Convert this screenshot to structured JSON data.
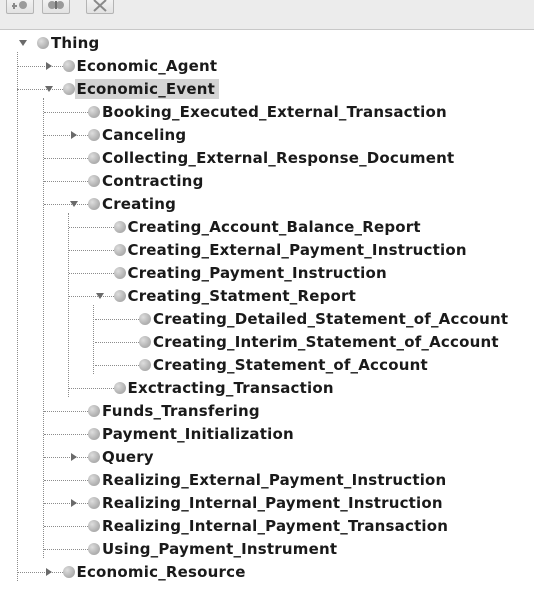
{
  "toolbar": {
    "buttons": [
      {
        "icon": "add-subclass-icon"
      },
      {
        "icon": "add-sibling-icon"
      },
      {
        "icon": "delete-class-icon"
      }
    ]
  },
  "colors": {
    "selection": "#d4d4d4",
    "node_dot": "#b6b6b6",
    "text": "#1a1a1a",
    "connector": "#8c8c8c"
  },
  "tree": {
    "nodes": [
      {
        "label": "Thing",
        "depth": 0,
        "state": "expanded",
        "selected": false
      },
      {
        "label": "Economic_Agent",
        "depth": 1,
        "state": "collapsed",
        "selected": false
      },
      {
        "label": "Economic_Event",
        "depth": 1,
        "state": "expanded",
        "selected": true
      },
      {
        "label": "Booking_Executed_External_Transaction",
        "depth": 2,
        "state": "leaf",
        "selected": false
      },
      {
        "label": "Canceling",
        "depth": 2,
        "state": "collapsed",
        "selected": false
      },
      {
        "label": "Collecting_External_Response_Document",
        "depth": 2,
        "state": "leaf",
        "selected": false
      },
      {
        "label": "Contracting",
        "depth": 2,
        "state": "leaf",
        "selected": false
      },
      {
        "label": "Creating",
        "depth": 2,
        "state": "expanded",
        "selected": false
      },
      {
        "label": "Creating_Account_Balance_Report",
        "depth": 3,
        "state": "leaf",
        "selected": false
      },
      {
        "label": "Creating_External_Payment_Instruction",
        "depth": 3,
        "state": "leaf",
        "selected": false
      },
      {
        "label": "Creating_Payment_Instruction",
        "depth": 3,
        "state": "leaf",
        "selected": false
      },
      {
        "label": "Creating_Statment_Report",
        "depth": 3,
        "state": "expanded",
        "selected": false
      },
      {
        "label": "Creating_Detailed_Statement_of_Account",
        "depth": 4,
        "state": "leaf",
        "selected": false
      },
      {
        "label": "Creating_Interim_Statement_of_Account",
        "depth": 4,
        "state": "leaf",
        "selected": false
      },
      {
        "label": "Creating_Statement_of_Account",
        "depth": 4,
        "state": "leaf",
        "selected": false
      },
      {
        "label": "Exctracting_Transaction",
        "depth": 3,
        "state": "leaf",
        "selected": false
      },
      {
        "label": "Funds_Transfering",
        "depth": 2,
        "state": "leaf",
        "selected": false
      },
      {
        "label": "Payment_Initialization",
        "depth": 2,
        "state": "leaf",
        "selected": false
      },
      {
        "label": "Query",
        "depth": 2,
        "state": "collapsed",
        "selected": false
      },
      {
        "label": "Realizing_External_Payment_Instruction",
        "depth": 2,
        "state": "leaf",
        "selected": false
      },
      {
        "label": "Realizing_Internal_Payment_Instruction",
        "depth": 2,
        "state": "collapsed",
        "selected": false
      },
      {
        "label": "Realizing_Internal_Payment_Transaction",
        "depth": 2,
        "state": "leaf",
        "selected": false
      },
      {
        "label": "Using_Payment_Instrument",
        "depth": 2,
        "state": "leaf",
        "selected": false
      },
      {
        "label": "Economic_Resource",
        "depth": 1,
        "state": "collapsed",
        "selected": false
      }
    ]
  }
}
